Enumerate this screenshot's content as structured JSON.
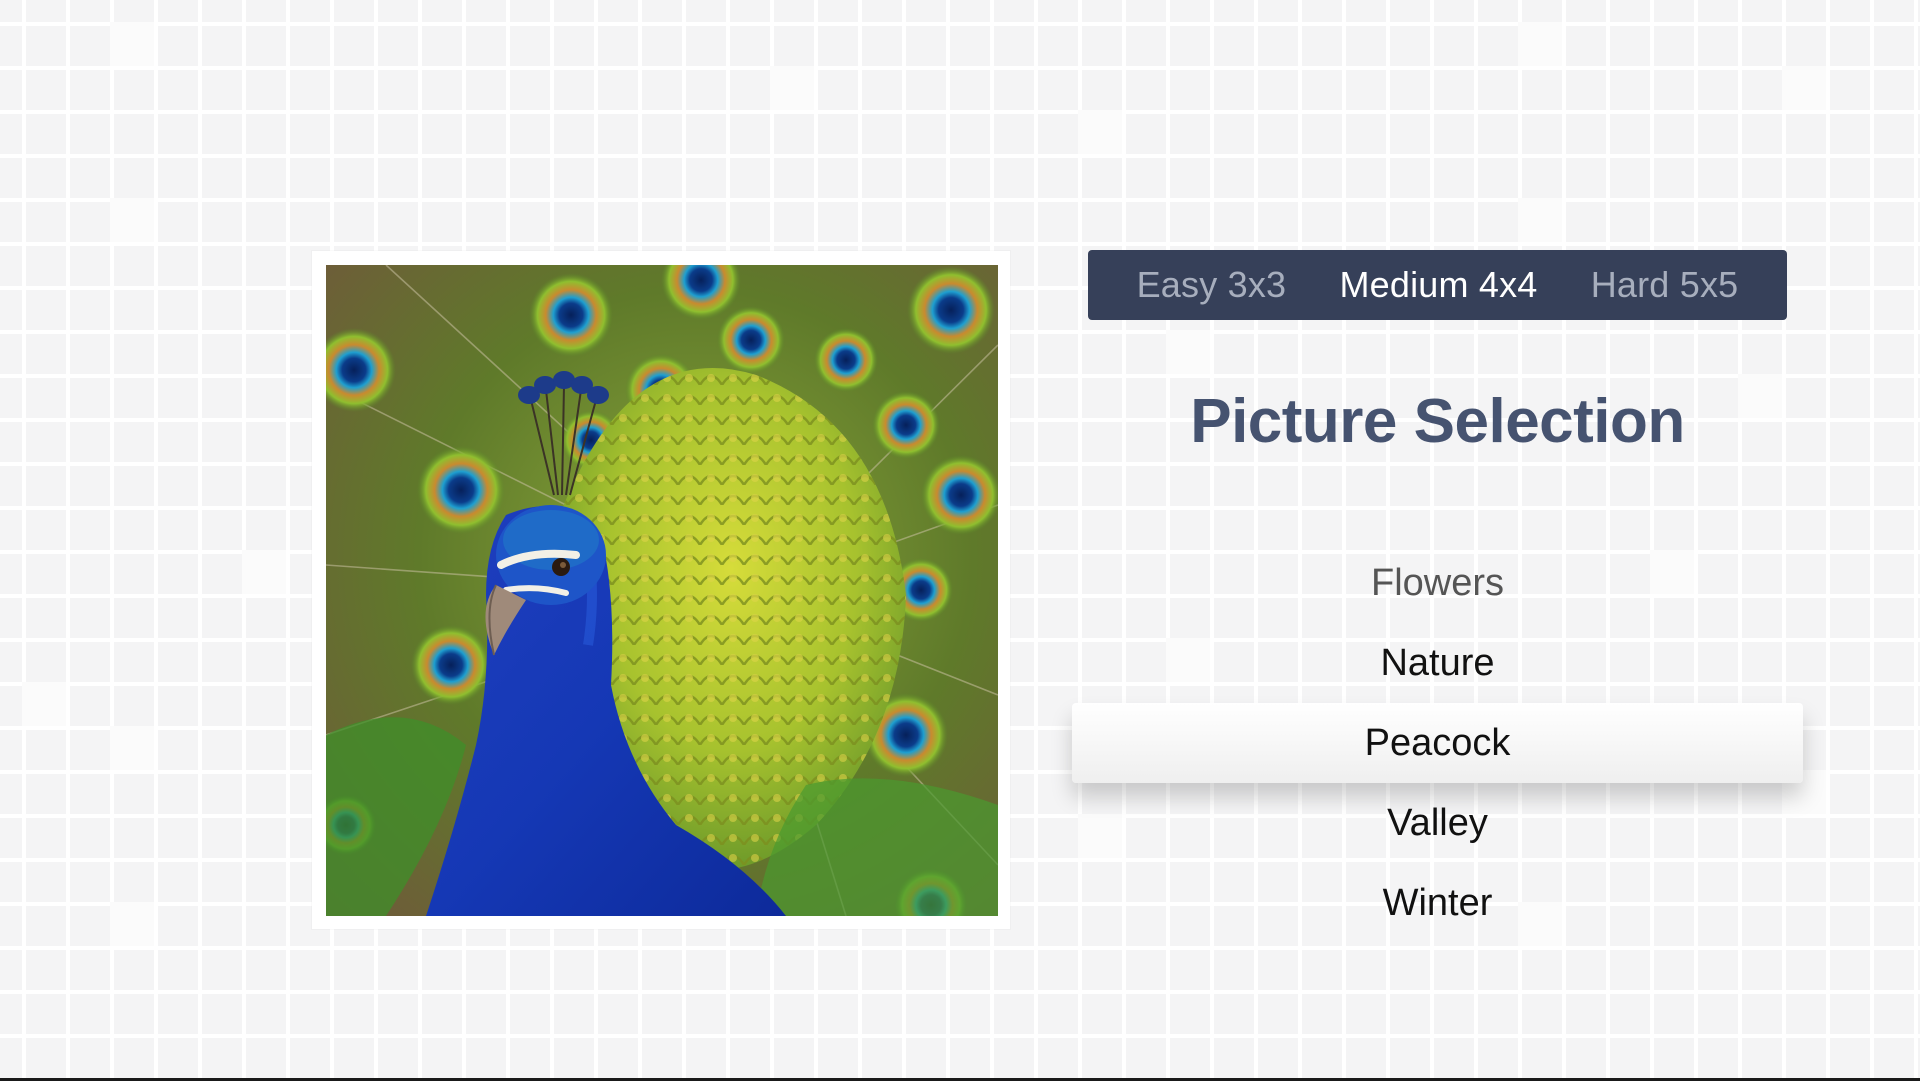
{
  "difficulty": {
    "options": [
      {
        "label": "Easy 3x3",
        "active": false
      },
      {
        "label": "Medium 4x4",
        "active": true
      },
      {
        "label": "Hard 5x5",
        "active": false
      }
    ]
  },
  "title": "Picture Selection",
  "pictures": {
    "items": [
      {
        "label": "Flowers",
        "state": "dim"
      },
      {
        "label": "Nature",
        "state": "normal"
      },
      {
        "label": "Peacock",
        "state": "selected"
      },
      {
        "label": "Valley",
        "state": "normal"
      },
      {
        "label": "Winter",
        "state": "normal"
      }
    ],
    "selected": "Peacock"
  },
  "preview": {
    "subject": "peacock-image"
  },
  "colors": {
    "difficulty_bar": "#364059",
    "title": "#465370",
    "background": "#f4f4f5"
  }
}
